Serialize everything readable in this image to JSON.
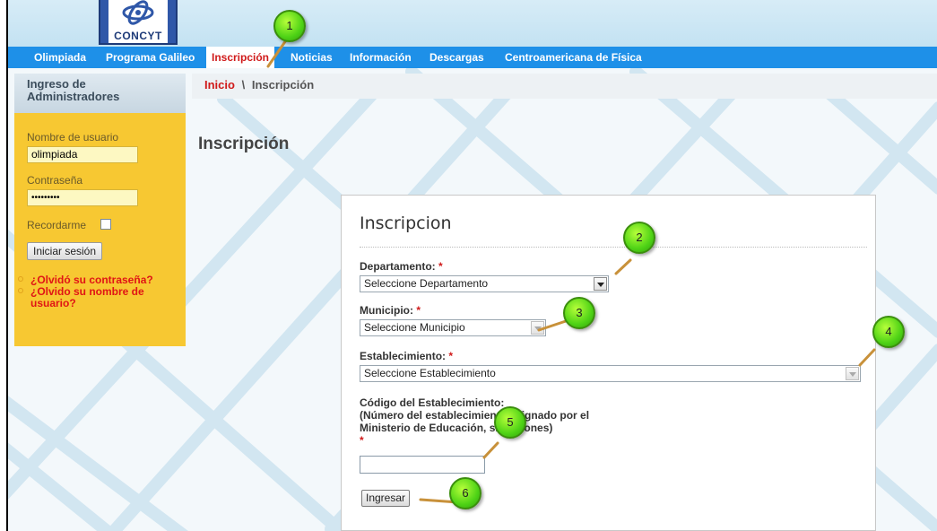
{
  "header": {
    "logo_text": "CONCYT",
    "colors": {
      "nav_bg": "#1e90e8",
      "active_tab_text": "#d01a1a",
      "sidebar_bg": "#f7c832",
      "callout": "#4fd316"
    }
  },
  "nav": {
    "items": [
      {
        "label": "Olimpiada"
      },
      {
        "label": "Programa Galileo"
      },
      {
        "label": "Inscripción",
        "active": true
      },
      {
        "label": "Noticias"
      },
      {
        "label": "Información"
      },
      {
        "label": "Descargas"
      },
      {
        "label": "Centroamericana de Física"
      }
    ]
  },
  "sidebar": {
    "title": "Ingreso de Administradores",
    "username_label": "Nombre de usuario",
    "username_value": "olimpiada",
    "password_label": "Contraseña",
    "password_value": "•••••••••",
    "remember_label": "Recordarme",
    "login_button": "Iniciar sesión",
    "links": [
      {
        "label": "¿Olvidó su contraseña?"
      },
      {
        "label": "¿Olvido su nombre de usuario?"
      }
    ]
  },
  "breadcrumb": {
    "home": "Inicio",
    "separator": "\\",
    "current": "Inscripción"
  },
  "page": {
    "title": "Inscripción"
  },
  "form": {
    "title": "Inscripcion",
    "required_mark": "*",
    "departamento": {
      "label": "Departamento:",
      "value": "Seleccione Departamento"
    },
    "municipio": {
      "label": "Municipio:",
      "value": "Seleccione Municipio"
    },
    "establecimiento": {
      "label": "Establecimiento:",
      "value": "Seleccione Establecimiento"
    },
    "codigo": {
      "label_lines": [
        "Código del Establecimiento:",
        "(Número del establecimiento asignado por el",
        "Ministerio de Educación, sin guiones)"
      ],
      "value": ""
    },
    "submit": "Ingresar"
  },
  "callouts": [
    "1",
    "2",
    "3",
    "4",
    "5",
    "6"
  ]
}
